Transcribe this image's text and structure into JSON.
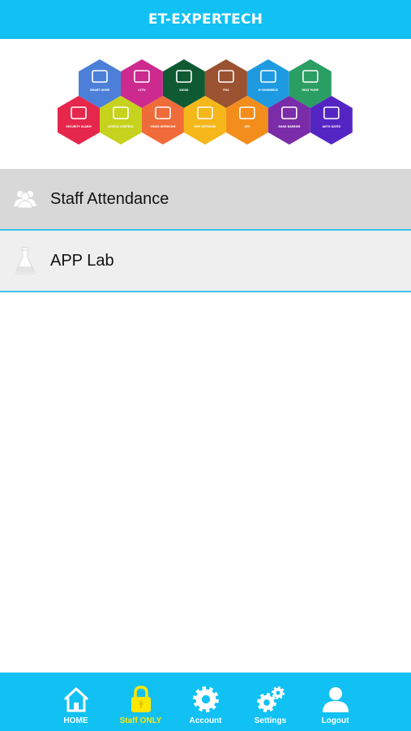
{
  "header": {
    "title": "ET-EXPERTECH"
  },
  "banner": {
    "row1": [
      {
        "label": "SMART HOME",
        "color": "#4c7fd8",
        "icon": "house-icon"
      },
      {
        "label": "CCTV",
        "color": "#cc2a8e",
        "icon": "cctv-camera-icon"
      },
      {
        "label": "KIOSK",
        "color": "#0f5a33",
        "icon": "kiosk-icon"
      },
      {
        "label": "POS",
        "color": "#9a5230",
        "icon": "cash-register-icon"
      },
      {
        "label": "E-COMMERCE",
        "color": "#1e9be0",
        "icon": "cart-icon"
      },
      {
        "label": "HEAT PUMP",
        "color": "#2b9e63",
        "icon": "aircon-icon"
      }
    ],
    "row2": [
      {
        "label": "SECURITY ALARM",
        "color": "#e6274c",
        "icon": "alarm-house-icon"
      },
      {
        "label": "ACCESS CONTROL",
        "color": "#c6d21d",
        "icon": "access-control-icon"
      },
      {
        "label": "VIDEO INTERCOM",
        "color": "#f06b3a",
        "icon": "intercom-icon"
      },
      {
        "label": "WIFI NETWORK",
        "color": "#f5b71a",
        "icon": "wifi-icon"
      },
      {
        "label": "GPS",
        "color": "#f38d1b",
        "icon": "gps-car-icon"
      },
      {
        "label": "ROAD BARRIER",
        "color": "#7b2ca8",
        "icon": "barrier-icon"
      },
      {
        "label": "AUTO GATES",
        "color": "#5525c4",
        "icon": "gate-icon"
      }
    ]
  },
  "menu": [
    {
      "label": "Staff Attendance",
      "icon": "users-icon"
    },
    {
      "label": "APP Lab",
      "icon": "flask-icon"
    }
  ],
  "tabs": [
    {
      "label": "HOME",
      "icon": "home-icon",
      "active": false
    },
    {
      "label": "Staff ONLY",
      "icon": "lock-icon",
      "active": true
    },
    {
      "label": "Account",
      "icon": "gear-icon",
      "active": false
    },
    {
      "label": "Settings",
      "icon": "gears-icon",
      "active": false
    },
    {
      "label": "Logout",
      "icon": "user-icon",
      "active": false
    }
  ],
  "colors": {
    "accent": "#11c1f3",
    "active_tab": "#ffe600",
    "divider": "#3cc3ea"
  }
}
